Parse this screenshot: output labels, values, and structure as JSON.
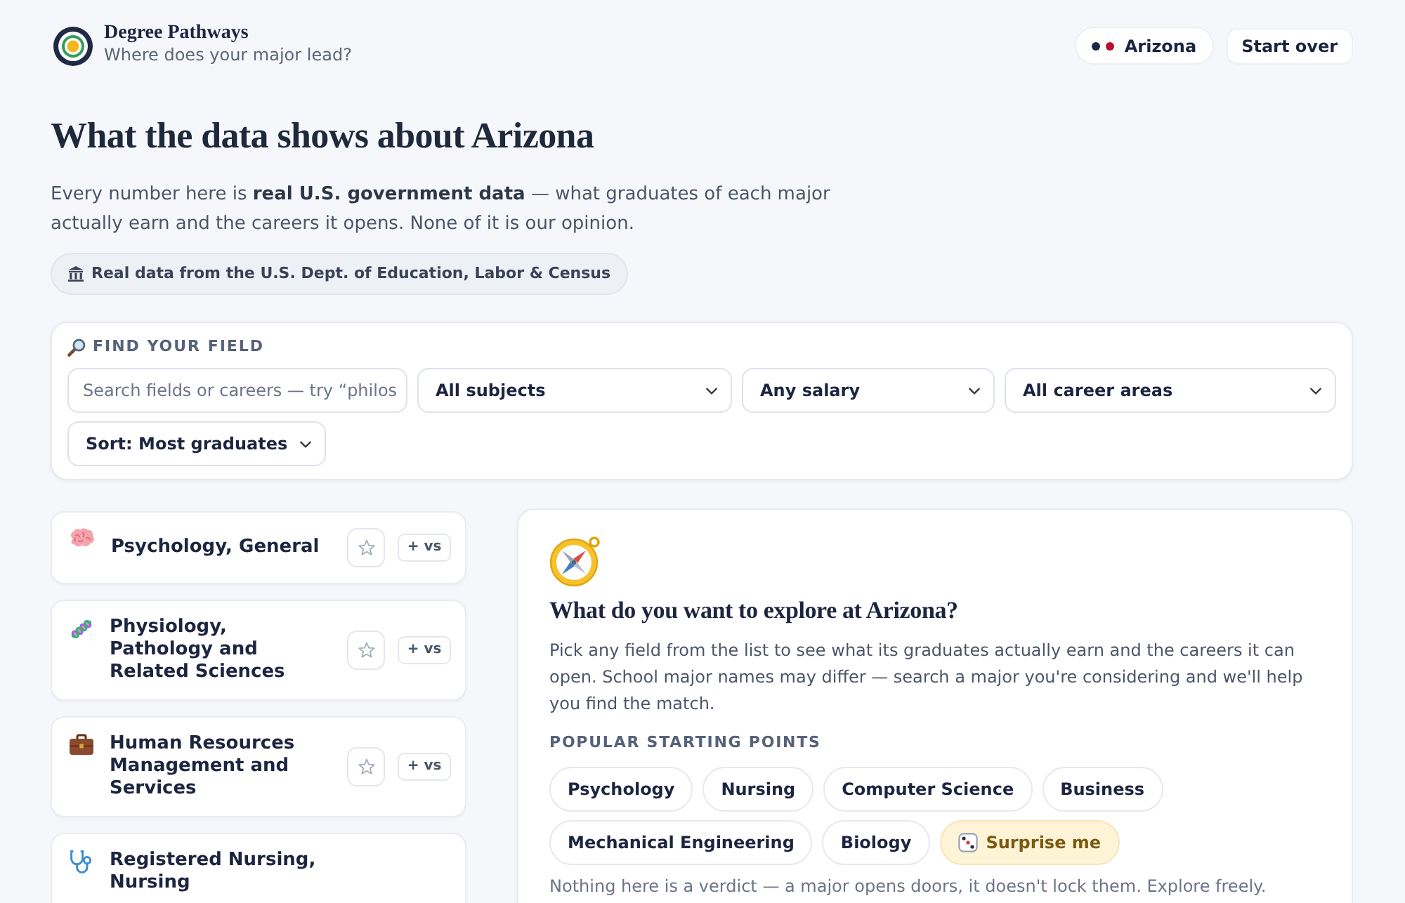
{
  "header": {
    "title": "Degree Pathways",
    "tagline": "Where does your major lead?",
    "location": {
      "label": "Arizona",
      "dots": [
        {
          "color": "#1b2a4a"
        },
        {
          "color": "#b8102c"
        }
      ]
    },
    "start_over": "Start over"
  },
  "intro": {
    "heading": "What the data shows about Arizona",
    "text": "Every number here is **real U.S. government data** — what graduates of each major actually earn and the careers it opens. None of it is our opinion.",
    "source_badge": "Real data from the U.S. Dept. of Education, Labor & Census"
  },
  "filters": {
    "label": "FIND YOUR FIELD",
    "search": {
      "placeholder": "Search fields or careers — try “philos"
    },
    "dropdowns": [
      {
        "value": "All subjects"
      },
      {
        "value": "Any salary"
      },
      {
        "value": "All career areas"
      },
      {
        "value": "Sort: Most graduates"
      }
    ]
  },
  "fields": [
    {
      "title": "Psychology, General",
      "starred": false,
      "compare": "+ vs"
    },
    {
      "title": "Physiology, Pathology and Related Sciences",
      "starred": false,
      "compare": "+ vs"
    },
    {
      "title": "Human Resources Management and Services",
      "starred": false,
      "compare": "+ vs"
    },
    {
      "title": "Registered Nursing, Nursing"
    }
  ],
  "explore": {
    "heading": "What do you want to explore at Arizona?",
    "text": "Pick any field from the list to see what its graduates actually earn and the careers it can open. School major names may differ — search a major you're considering and we'll help you find the match.",
    "popular_label": "POPULAR STARTING POINTS",
    "chips": [
      {
        "label": "Psychology",
        "kind": "topic"
      },
      {
        "label": "Nursing",
        "kind": "topic"
      },
      {
        "label": "Computer Science",
        "kind": "topic"
      },
      {
        "label": "Business",
        "kind": "topic"
      },
      {
        "label": "Mechanical Engineering",
        "kind": "topic"
      },
      {
        "label": "Biology",
        "kind": "topic"
      },
      {
        "label": "Surprise me",
        "kind": "random"
      }
    ],
    "note": "Nothing here is a verdict — a major opens doors, it doesn't lock them. Explore freely."
  }
}
